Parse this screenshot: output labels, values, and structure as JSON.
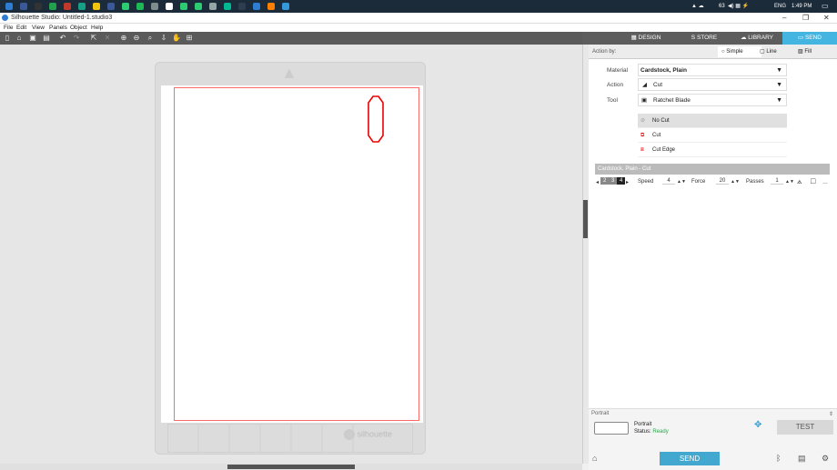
{
  "taskbar": {
    "colors": [
      "#2d7dd2",
      "#3b5998",
      "#333333",
      "#22a04b",
      "#c0392b",
      "#16a085",
      "#f1c40f",
      "#3b5998",
      "#2ecc71",
      "#1db954",
      "#7f8c8d",
      "#ffffff",
      "#2ecc71",
      "#2ecc71",
      "#95a5a6",
      "#00b894",
      "#2c3e50",
      "#2d7dd2",
      "#ff7f00",
      "#3498db"
    ],
    "tray": {
      "battery": "63",
      "lang": "ENG",
      "time": "1:49 PM"
    }
  },
  "window": {
    "title": "Silhouette Studio: Untitled-1.studio3",
    "min": "–",
    "max": "❐",
    "close": "✕"
  },
  "menu": [
    "File",
    "Edit",
    "View",
    "Panels",
    "Object",
    "Help"
  ],
  "nav": {
    "design": "DESIGN",
    "store": "STORE",
    "library": "LIBRARY",
    "send": "SEND",
    "active_color": "#43b5e0"
  },
  "canvas": {
    "watermark": "silhouette"
  },
  "action_by": {
    "label": "Action by:",
    "simple": "Simple",
    "line": "Line",
    "fill": "Fill"
  },
  "props": {
    "material_label": "Material",
    "material_value": "Cardstock, Plain",
    "action_label": "Action",
    "action_value": "Cut",
    "tool_label": "Tool",
    "tool_value": "Ratchet Blade"
  },
  "cut_options": [
    "No Cut",
    "Cut",
    "Cut Edge"
  ],
  "settings": {
    "material_row": "Cardstock, Plain - Cut",
    "steps": [
      "2",
      "3",
      "4"
    ],
    "speed_label": "Speed",
    "speed": "4",
    "force_label": "Force",
    "force": "20",
    "passes_label": "Passes",
    "passes": "1"
  },
  "device": {
    "section": "Portrait",
    "name": "Portrait",
    "status_label": "Status:",
    "status": "Ready",
    "status_color": "#2aa84a",
    "test": "TEST",
    "send": "SEND"
  }
}
